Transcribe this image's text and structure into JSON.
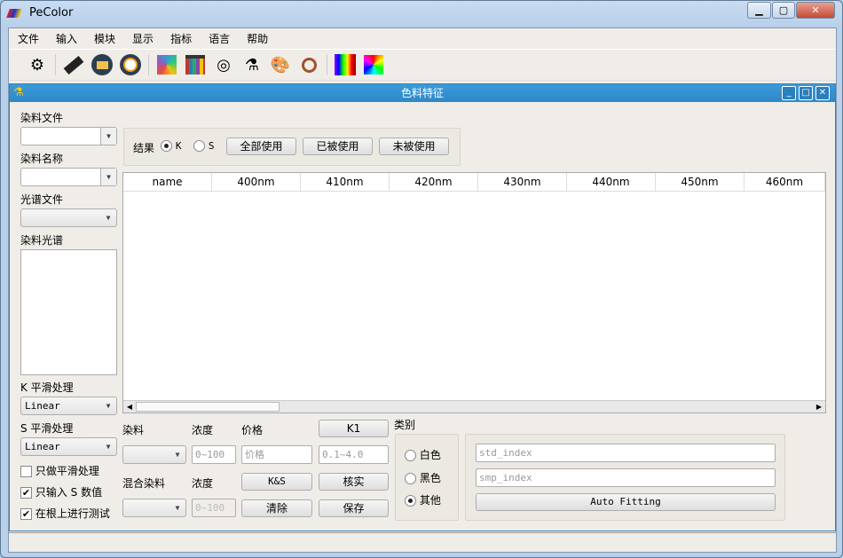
{
  "window": {
    "title": "PeColor",
    "minimize": "▁",
    "maximize": "▢",
    "close": "✕"
  },
  "menu": [
    "文件",
    "输入",
    "模块",
    "显示",
    "指标",
    "语言",
    "帮助"
  ],
  "toolbar_icons": [
    "settings-sync-icon",
    "keyboard-icon",
    "folder-icon",
    "light-icon",
    "color-fan-icon",
    "color-chart-icon",
    "rgb-circles-icon",
    "lab-instrument-icon",
    "palette-icon",
    "magnifier-icon",
    "spectrum-icon",
    "color-square-icon"
  ],
  "subwindow": {
    "title": "色料特征"
  },
  "left": {
    "dye_file_label": "染料文件",
    "dye_file_value": "",
    "dye_name_label": "染料名称",
    "dye_name_value": "",
    "spectrum_file_label": "光谱文件",
    "spectrum_file_value": "",
    "dye_spectrum_label": "染料光谱",
    "k_smooth_label": "K 平滑处理",
    "k_smooth_value": "Linear",
    "s_smooth_label": "S 平滑处理",
    "s_smooth_value": "Linear",
    "checks": [
      {
        "label": "只做平滑处理",
        "checked": false
      },
      {
        "label": "只输入 S 数值",
        "checked": true
      },
      {
        "label": "在根上进行测试",
        "checked": true
      }
    ]
  },
  "result": {
    "label": "结果",
    "options": [
      "K",
      "S"
    ],
    "selected": "K",
    "btn_all": "全部使用",
    "btn_used": "已被使用",
    "btn_unused": "未被使用"
  },
  "table": {
    "columns": [
      "name",
      "400nm",
      "410nm",
      "420nm",
      "430nm",
      "440nm",
      "450nm",
      "460nm"
    ],
    "rows": []
  },
  "bottom": {
    "dye_label": "染料",
    "conc_label": "浓度",
    "price_label": "价格",
    "k1_button": "K1",
    "dye_value": "",
    "conc_placeholder": "0~100",
    "price_placeholder": "价格",
    "range_placeholder": "0.1~4.0",
    "mix_label": "混合染料",
    "mix_conc_label": "浓度",
    "ks_button": "K&S",
    "verify_button": "核实",
    "mix_value": "",
    "mix_conc_placeholder": "0~100",
    "clear_button": "清除",
    "save_button": "保存"
  },
  "category": {
    "label": "类别",
    "options": [
      "白色",
      "黑色",
      "其他"
    ],
    "selected": "其他"
  },
  "fitting": {
    "std_placeholder": "std_index",
    "smp_placeholder": "smp_index",
    "button": "Auto Fitting"
  }
}
